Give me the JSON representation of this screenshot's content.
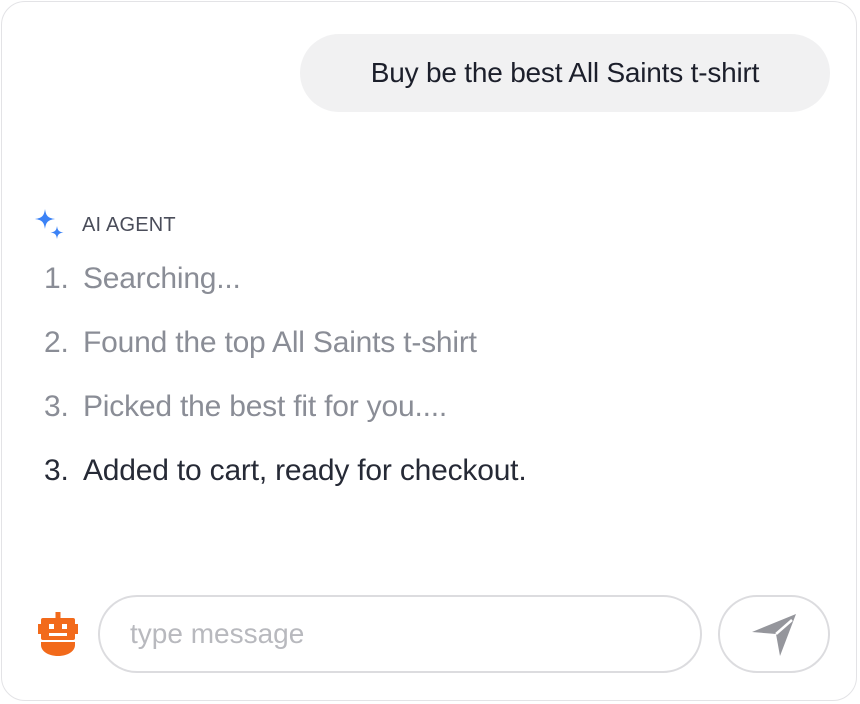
{
  "conversation": {
    "user_message": "Buy be the best All Saints t-shirt"
  },
  "agent": {
    "label": "AI AGENT",
    "icon": "sparkle-icon",
    "accent_color": "#3b82f6",
    "steps": [
      {
        "number": "1.",
        "text": "Searching...",
        "status": "done"
      },
      {
        "number": "2.",
        "text": "Found the top All Saints t-shirt",
        "status": "done"
      },
      {
        "number": "3.",
        "text": "Picked the best fit for you....",
        "status": "done"
      },
      {
        "number": "3.",
        "text": "Added to cart, ready for checkout.",
        "status": "current"
      }
    ]
  },
  "composer": {
    "avatar_icon": "robot-icon",
    "avatar_color": "#f26a1b",
    "placeholder": "type message",
    "value": "",
    "send_icon": "send-icon"
  }
}
